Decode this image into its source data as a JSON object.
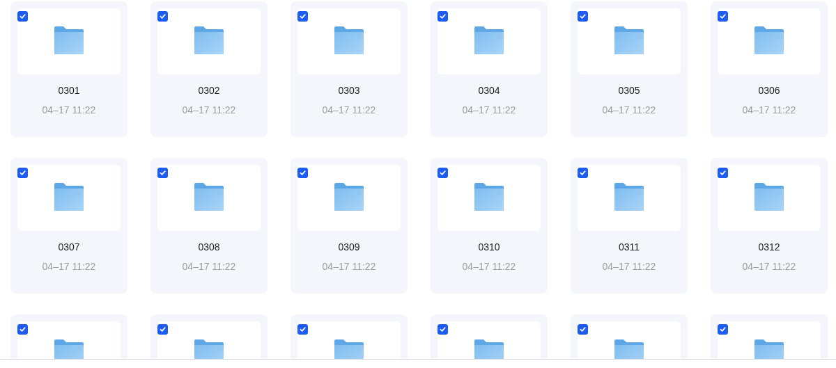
{
  "items": [
    {
      "name": "0301",
      "time": "04–17 11:22",
      "checked": true
    },
    {
      "name": "0302",
      "time": "04–17 11:22",
      "checked": true
    },
    {
      "name": "0303",
      "time": "04–17 11:22",
      "checked": true
    },
    {
      "name": "0304",
      "time": "04–17 11:22",
      "checked": true
    },
    {
      "name": "0305",
      "time": "04–17 11:22",
      "checked": true
    },
    {
      "name": "0306",
      "time": "04–17 11:22",
      "checked": true
    },
    {
      "name": "0307",
      "time": "04–17 11:22",
      "checked": true
    },
    {
      "name": "0308",
      "time": "04–17 11:22",
      "checked": true
    },
    {
      "name": "0309",
      "time": "04–17 11:22",
      "checked": true
    },
    {
      "name": "0310",
      "time": "04–17 11:22",
      "checked": true
    },
    {
      "name": "0311",
      "time": "04–17 11:22",
      "checked": true
    },
    {
      "name": "0312",
      "time": "04–17 11:22",
      "checked": true
    },
    {
      "checked": true
    },
    {
      "checked": true
    },
    {
      "checked": true
    },
    {
      "checked": true
    },
    {
      "checked": true
    },
    {
      "checked": true
    }
  ]
}
